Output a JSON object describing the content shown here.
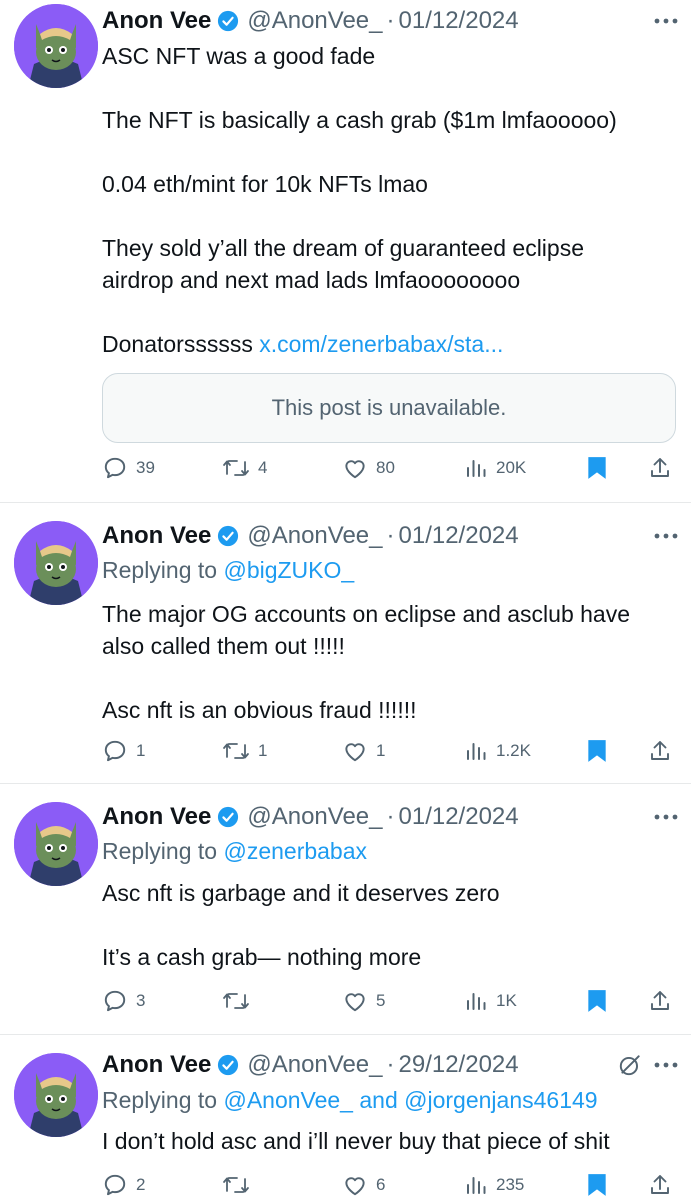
{
  "colors": {
    "accent": "#1d9bf0",
    "muted": "#536471",
    "text": "#0f1419",
    "avatar_bg": "#8b5cf6",
    "bookmark": "#1d9bf0"
  },
  "tweets": [
    {
      "name": "Anon Vee",
      "handle": "@AnonVee_",
      "sep": "·",
      "date": "01/12/2024",
      "lines": [
        "ASC NFT was a good fade",
        "",
        "The NFT is basically a cash grab ($1m lmfaooooo)",
        "",
        "0.04 eth/mint for 10k NFTs lmao",
        "",
        "They sold y’all the dream of guaranteed eclipse",
        "airdrop and next mad lads lmfaoooooooo",
        ""
      ],
      "last_text": "Donatorssssss ",
      "link": "x.com/zenerbabax/sta...",
      "quote": "This post is unavailable.",
      "replies": "39",
      "reposts": "4",
      "likes": "80",
      "views": "20K"
    },
    {
      "name": "Anon Vee",
      "handle": "@AnonVee_",
      "sep": "·",
      "date": "01/12/2024",
      "reply_prefix": "Replying to ",
      "reply_to": "@bigZUKO_",
      "lines": [
        "The major OG accounts on eclipse and asclub have",
        "also called them out !!!!!",
        "",
        "Asc nft is an obvious fraud !!!!!!"
      ],
      "replies": "1",
      "reposts": "1",
      "likes": "1",
      "views": "1.2K"
    },
    {
      "name": "Anon Vee",
      "handle": "@AnonVee_",
      "sep": "·",
      "date": "01/12/2024",
      "reply_prefix": "Replying to ",
      "reply_to": "@zenerbabax",
      "lines": [
        "Asc nft is garbage and it deserves zero",
        "",
        "It’s a cash grab— nothing more"
      ],
      "replies": "3",
      "reposts": "",
      "likes": "5",
      "views": "1K"
    },
    {
      "name": "Anon Vee",
      "handle": "@AnonVee_",
      "sep": "·",
      "date": "29/12/2024",
      "reply_prefix": "Replying to ",
      "reply_to": "@AnonVee_ and @jorgenjans46149",
      "lines": [
        "I don’t hold asc and i’ll never buy that piece of shit"
      ],
      "replies": "2",
      "reposts": "",
      "likes": "6",
      "views": "235"
    }
  ],
  "icons": {
    "avatar": "cat-avatar-icon",
    "verified": "verified-badge-icon",
    "more": "more-icon",
    "grok": "grok-icon",
    "reply": "reply-icon",
    "repost": "repost-icon",
    "like": "like-icon",
    "views": "views-icon",
    "bookmark": "bookmark-icon",
    "share": "share-icon"
  }
}
